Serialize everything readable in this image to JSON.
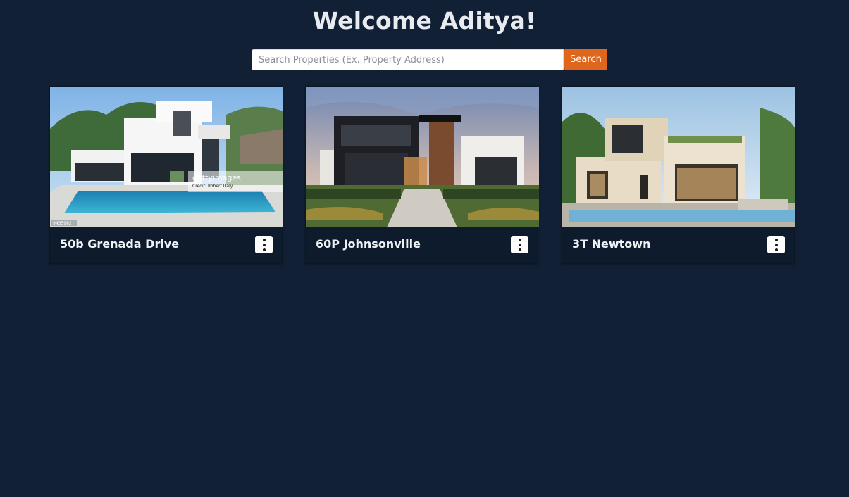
{
  "header": {
    "title": "Welcome Aditya!"
  },
  "search": {
    "placeholder": "Search Properties (Ex. Property Address)",
    "value": "",
    "button_label": "Search"
  },
  "properties": [
    {
      "title": "50b Grenada Drive",
      "image_watermark": "gettyimages",
      "image_credit": "Credit: Robert Daly",
      "image_tag": "9435962"
    },
    {
      "title": "60P Johnsonville"
    },
    {
      "title": "3T Newtown"
    }
  ],
  "colors": {
    "background": "#112034",
    "card": "#0e1b2d",
    "accent": "#e0661b"
  }
}
